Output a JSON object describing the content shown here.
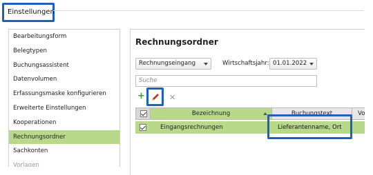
{
  "window": {
    "title": "Einstellungen"
  },
  "sidebar": {
    "items": [
      {
        "label": "Bearbeitungsform"
      },
      {
        "label": "Belegtypen"
      },
      {
        "label": "Buchungsassistent"
      },
      {
        "label": "Datenvolumen"
      },
      {
        "label": "Erfassungsmaske konfigurieren"
      },
      {
        "label": "Erweiterte Einstellungen"
      },
      {
        "label": "Kooperationen"
      },
      {
        "label": "Rechnungsordner",
        "active": true
      },
      {
        "label": "Sachkonten"
      },
      {
        "label": "Vorlagen"
      }
    ]
  },
  "main": {
    "title": "Rechnungsordner",
    "type_select": {
      "value": "Rechnungseingang"
    },
    "fiscal_year": {
      "label": "Wirtschaftsjahr:",
      "value": "01.01.2022"
    },
    "search": {
      "placeholder": "Suche"
    },
    "toolbar": {
      "add_icon": "plus-icon",
      "edit_icon": "pencil-icon",
      "delete_icon": "x-icon"
    },
    "grid": {
      "columns": [
        "Bezeichnung",
        "Buchungstext",
        "Vo"
      ],
      "rows": [
        {
          "checked": true,
          "bezeichnung": "Eingangsrechnungen",
          "buchungstext": "Lieferantenname, Ort"
        }
      ]
    }
  },
  "colors": {
    "highlight": "#1f5fbf",
    "accent_green": "#b9d98a",
    "add_green": "#3f9a2a",
    "edit_red": "#c0392b"
  }
}
